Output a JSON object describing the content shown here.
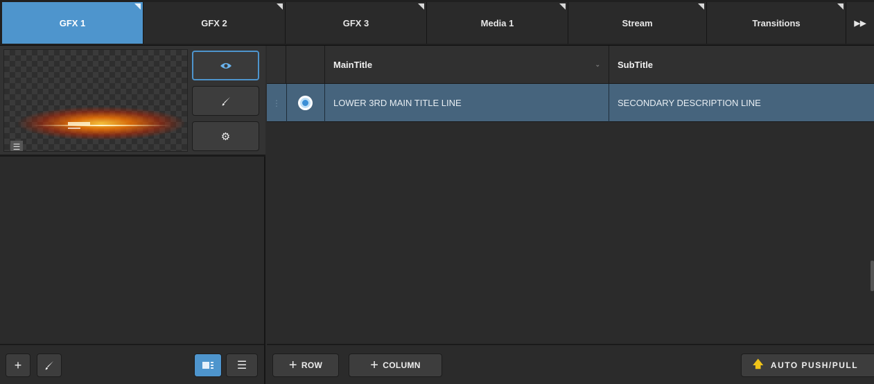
{
  "tabs": [
    {
      "label": "GFX 1",
      "active": true
    },
    {
      "label": "GFX 2",
      "active": false
    },
    {
      "label": "GFX 3",
      "active": false
    },
    {
      "label": "Media 1",
      "active": false
    },
    {
      "label": "Stream",
      "active": false
    },
    {
      "label": "Transitions",
      "active": false
    }
  ],
  "tab_more_icon": "double-chevron-right-icon",
  "gfx_item": {
    "preview_icon": "eye-icon",
    "edit_icon": "brush-icon",
    "settings_icon": "gear-icon",
    "list_icon": "list-icon"
  },
  "left_footer": {
    "add_icon": "plus-icon",
    "edit_icon": "brush-icon",
    "grid_view_icon": "thumbnail-view-icon",
    "list_view_icon": "list-view-icon"
  },
  "table": {
    "columns": [
      "MainTitle",
      "SubTitle"
    ],
    "rows": [
      {
        "selected": true,
        "cells": [
          "LOWER 3RD MAIN TITLE LINE",
          "SECONDARY DESCRIPTION LINE"
        ]
      }
    ]
  },
  "right_footer": {
    "add_row_label": "ROW",
    "add_column_label": "COLUMN",
    "auto_push_label": "AUTO PUSH/PULL"
  },
  "colors": {
    "accent": "#4e95cd",
    "selected_row": "#46647d",
    "background": "#2b2b2b",
    "auto_push_arrow": "#f0c419"
  }
}
